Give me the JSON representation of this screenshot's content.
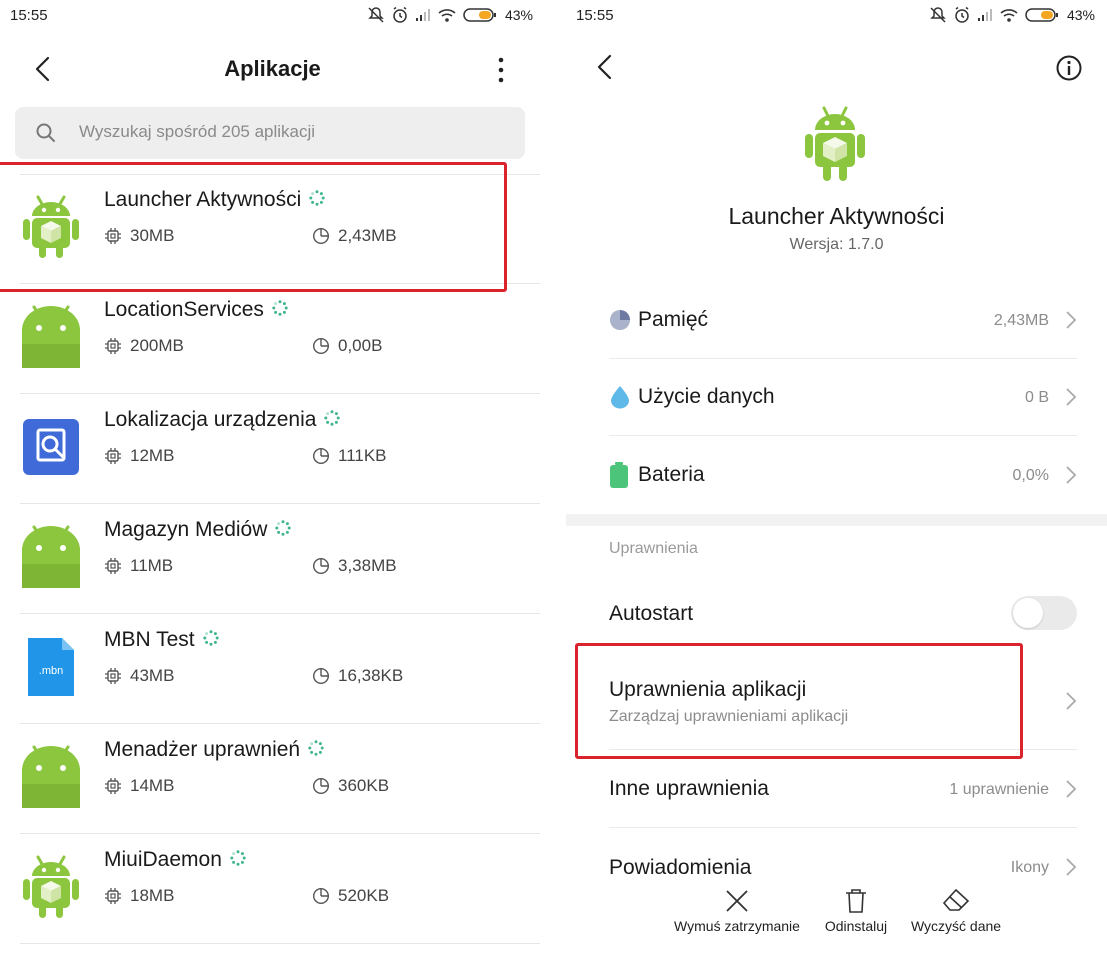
{
  "left": {
    "status": {
      "time": "15:55",
      "battery": "43%"
    },
    "title": "Aplikacje",
    "search": {
      "placeholder": "Wyszukaj spośród 205 aplikacji"
    },
    "apps": [
      {
        "name": "Launcher Aktywności",
        "size": "30MB",
        "storage": "2,43MB",
        "icon": "android-box-icon"
      },
      {
        "name": "LocationServices",
        "size": "200MB",
        "storage": "0,00B",
        "icon": "android-default-icon"
      },
      {
        "name": "Lokalizacja urządzenia",
        "size": "12MB",
        "storage": "111KB",
        "icon": "location-search-icon"
      },
      {
        "name": "Magazyn Mediów",
        "size": "11MB",
        "storage": "3,38MB",
        "icon": "android-default-icon"
      },
      {
        "name": "MBN Test",
        "size": "43MB",
        "storage": "16,38KB",
        "icon": "mbn-file-icon"
      },
      {
        "name": "Menadżer uprawnień",
        "size": "14MB",
        "storage": "360KB",
        "icon": "android-default-icon"
      },
      {
        "name": "MiuiDaemon",
        "size": "18MB",
        "storage": "520KB",
        "icon": "android-box-icon"
      }
    ]
  },
  "right": {
    "status": {
      "time": "15:55",
      "battery": "43%"
    },
    "app_name": "Launcher Aktywności",
    "version": "Wersja: 1.7.0",
    "rows": {
      "memory": {
        "label": "Pamięć",
        "value": "2,43MB"
      },
      "data": {
        "label": "Użycie danych",
        "value": "0 B"
      },
      "battery": {
        "label": "Bateria",
        "value": "0,0%"
      }
    },
    "section_permissions": "Uprawnienia",
    "autostart": {
      "label": "Autostart",
      "enabled": false
    },
    "app_permissions": {
      "label": "Uprawnienia aplikacji",
      "sub": "Zarządzaj uprawnieniami aplikacji"
    },
    "other_permissions": {
      "label": "Inne uprawnienia",
      "value": "1 uprawnienie"
    },
    "notifications": {
      "label": "Powiadomienia",
      "value": "Ikony"
    },
    "actions": {
      "force_stop": "Wymuś zatrzymanie",
      "uninstall": "Odinstaluj",
      "clear_data": "Wyczyść dane"
    }
  },
  "colors": {
    "highlight": "#d9232d",
    "android_green": "#8cc63f",
    "text": "#1a1a1a"
  }
}
